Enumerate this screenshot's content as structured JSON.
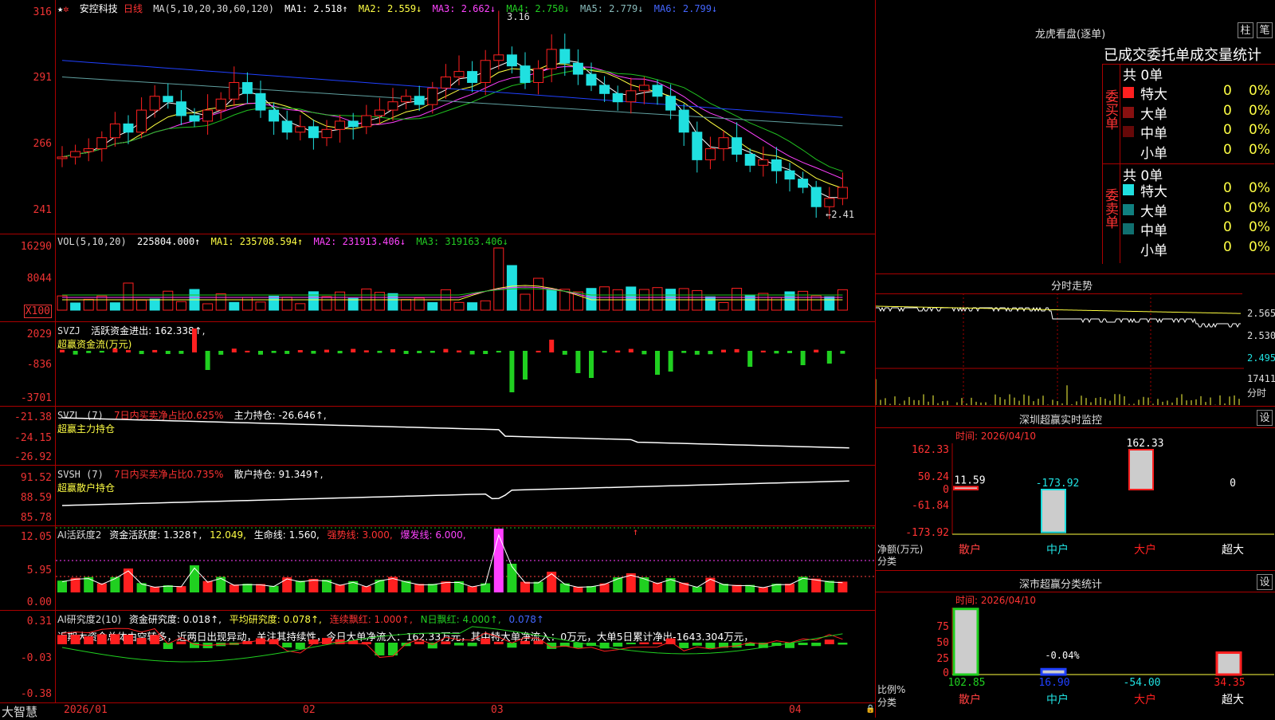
{
  "colors": {
    "up": "#ff2020",
    "down": "#20e0e0",
    "ma1": "#ffffff",
    "ma2": "#ffff40",
    "ma3": "#ff40ff",
    "ma4": "#20c020",
    "ma5": "#60a0a0",
    "ma6": "#2040ff",
    "frame": "#aa0000"
  },
  "main": {
    "stock_name": "安控科技",
    "period": "日线",
    "ma_label": "MA(5,10,20,30,60,120)",
    "ma1": "MA1: 2.518↑",
    "ma2": "MA2: 2.559↓",
    "ma3": "MA3: 2.662↓",
    "ma4": "MA4: 2.750↓",
    "ma5": "MA5: 2.779↓",
    "ma6": "MA6: 2.799↓",
    "ticks": [
      "316",
      "291",
      "266",
      "241"
    ],
    "high_label": "3.16",
    "low_label": "←2.41"
  },
  "vol": {
    "label": "VOL(5,10,20)",
    "value": "225804.000↑",
    "ma1": "MA1: 235708.594↑",
    "ma2": "MA2: 231913.406↓",
    "ma3": "MA3: 319163.406↓",
    "ticks": [
      "16290",
      "8044",
      "X100"
    ]
  },
  "svzj": {
    "label": "SVZJ",
    "title": "活跃资金进出: 162.338↑,",
    "sub": "超赢资金流(万元)",
    "ticks": [
      "2029",
      "-836",
      "-3701"
    ]
  },
  "svzl": {
    "label": "SVZL (7)",
    "ratio": "7日内买卖净占比0.625%",
    "hold": "主力持仓: -26.646↑,",
    "sub": "超赢主力持仓",
    "ticks": [
      "-21.38",
      "-24.15",
      "-26.92"
    ]
  },
  "svsh": {
    "label": "SVSH (7)",
    "ratio": "7日内买卖净占比0.735%",
    "hold": "散户持仓: 91.349↑,",
    "sub": "超赢散户持仓",
    "ticks": [
      "91.52",
      "88.59",
      "85.78"
    ]
  },
  "ai2": {
    "title": "AI活跃度2",
    "act": "资金活跃度: 1.328↑,",
    "v2": "12.049,",
    "life": "生命线: 1.560,",
    "strong": "强势线: 3.000,",
    "burst": "爆发线: 6.000,",
    "ticks": [
      "12.05",
      "5.95",
      "0.00"
    ],
    "arrow": "↑"
  },
  "ai10": {
    "title": "AI研究度2(10)",
    "res": "资金研究度: 0.018↑,",
    "avg": "平均研究度: 0.078↑,",
    "red": "连续飘红: 1.000↑,",
    "nred": "N日飘红: 4.000↑,",
    "last": "0.078↑",
    "comment": "近期大资金总体由空转多，近两日出现异动，关注其持续性，今日大单净流入：162.33万元，其中特大单净流入：0万元，大单5日累计净出-1643.304万元，",
    "ticks": [
      "0.31",
      "-0.03",
      "-0.38"
    ]
  },
  "xaxis": {
    "labels": [
      "2026/01",
      "02",
      "03",
      "04"
    ],
    "brand": "大智慧"
  },
  "longhu": {
    "title": "龙虎看盘(逐单)",
    "btn1": "柱",
    "btn2": "笔",
    "header": "已成交委托单成交量统计",
    "buy_label": "委买单",
    "sell_label": "委卖单",
    "buy_total": "共 0单",
    "sell_total": "共 0单",
    "buy_rows": [
      {
        "name": "特大",
        "v": "0",
        "p": "0%"
      },
      {
        "name": "大单",
        "v": "0",
        "p": "0%"
      },
      {
        "name": "中单",
        "v": "0",
        "p": "0%"
      },
      {
        "name": "小单",
        "v": "0",
        "p": "0%"
      }
    ],
    "sell_rows": [
      {
        "name": "特大",
        "v": "0",
        "p": "0%"
      },
      {
        "name": "大单",
        "v": "0",
        "p": "0%"
      },
      {
        "name": "中单",
        "v": "0",
        "p": "0%"
      },
      {
        "name": "小单",
        "v": "0",
        "p": "0%"
      }
    ]
  },
  "fenshi": {
    "title": "分时走势",
    "ticks": [
      "2.565",
      "2.530",
      "2.495"
    ],
    "vol_tick": "17411",
    "vol_unit": "分时"
  },
  "monitor": {
    "title": "深圳超赢实时监控",
    "btn": "设",
    "time": "时间: 2026/04/10",
    "ticks": [
      "162.33",
      "50.24",
      "0",
      "-61.84",
      "-173.92"
    ],
    "unit": "净额(万元)",
    "cat": "分类",
    "bars": [
      {
        "name": "散户",
        "value": 11.59,
        "label": "11.59"
      },
      {
        "name": "中户",
        "value": -173.92,
        "label": "-173.92"
      },
      {
        "name": "大户",
        "value": 162.33,
        "label": "162.33"
      },
      {
        "name": "超大",
        "value": 0,
        "label": "0"
      }
    ]
  },
  "classify": {
    "title": "深市超赢分类统计",
    "btn": "设",
    "time": "时间: 2026/04/10",
    "ticks": [
      "75",
      "50",
      "25",
      "0"
    ],
    "unit": "比例%",
    "cat": "分类",
    "bars": [
      {
        "name": "散户",
        "value": 102.85,
        "label": "102.85"
      },
      {
        "name": "中户",
        "value": 16.9,
        "label": "16.90",
        "pct": "-0.04%"
      },
      {
        "name": "大户",
        "value": -54.0,
        "label": "-54.00"
      },
      {
        "name": "超大",
        "value": 34.35,
        "label": "34.35"
      }
    ]
  }
}
